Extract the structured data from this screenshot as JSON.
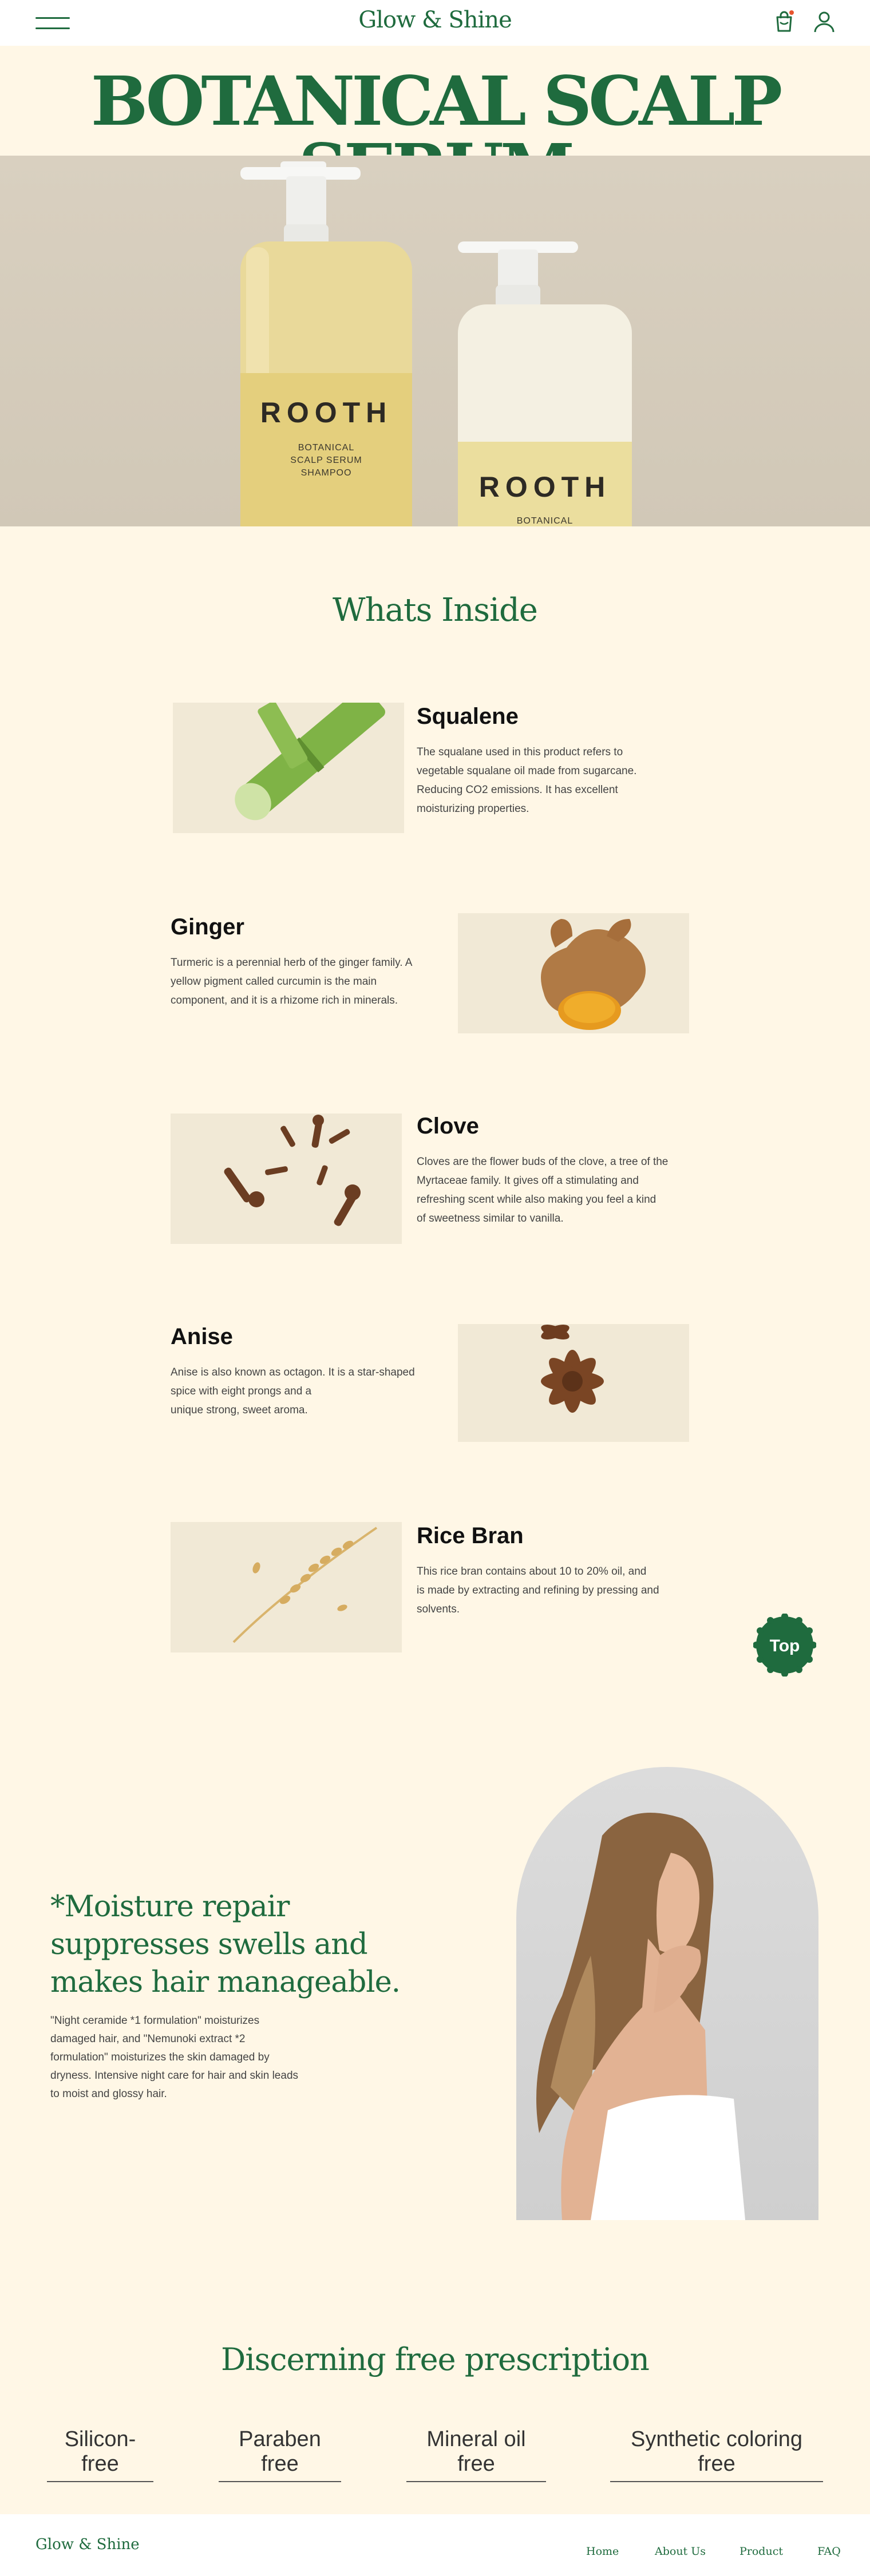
{
  "header": {
    "logo": "Glow & Shine"
  },
  "hero": {
    "title": "BOTANICAL SCALP SERUM",
    "bottle_left": {
      "brand": "ROOTH",
      "line1": "BOTANICAL",
      "line2": "SCALP SERUM",
      "line3": "SHAMPOO"
    },
    "bottle_right": {
      "brand": "ROOTH",
      "line1": "BOTANICAL"
    }
  },
  "whats_inside": {
    "title": "Whats Inside",
    "ingredients": [
      {
        "name": "Squalene",
        "desc": [
          "The squalane used in this product refers to",
          "vegetable squalane oil made from sugarcane.",
          "Reducing CO2 emissions. It has excellent",
          "moisturizing properties."
        ]
      },
      {
        "name": "Ginger",
        "desc": [
          "Turmeric is a perennial herb of the ginger family. A",
          "yellow pigment called curcumin is the main",
          "component, and it is a rhizome rich in minerals."
        ]
      },
      {
        "name": "Clove",
        "desc": [
          "Cloves are the flower buds of the clove, a tree of the",
          "Myrtaceae family. It gives off a stimulating and",
          "refreshing scent while also making you feel a kind",
          "of sweetness similar to vanilla."
        ]
      },
      {
        "name": "Anise",
        "desc": [
          "Anise is also known as octagon. It is a star-shaped",
          "spice with eight prongs and a",
          "unique strong, sweet aroma."
        ]
      },
      {
        "name": "Rice Bran",
        "desc": [
          "This rice bran contains about 10 to 20% oil, and",
          "is made by extracting and refining by pressing and",
          "solvents."
        ]
      }
    ]
  },
  "top_button": "Top",
  "moisture": {
    "title": [
      "*Moisture repair",
      "suppresses swells and",
      "makes hair manageable."
    ],
    "desc": [
      "\"Night ceramide *1 formulation\" moisturizes",
      "damaged hair, and \"Nemunoki extract *2",
      "formulation\" moisturizes the skin damaged by",
      "dryness. Intensive night care for hair and skin leads",
      "to moist and glossy hair."
    ]
  },
  "prescription": {
    "title": "Discerning free prescription",
    "items": [
      "Silicon-free",
      "Paraben free",
      "Mineral oil free",
      "Synthetic coloring free"
    ]
  },
  "footer": {
    "logo": "Glow & Shine",
    "links": [
      "Home",
      "About Us",
      "Product",
      "FAQ"
    ]
  },
  "colors": {
    "brand_green": "#1f6b3e",
    "background": "#fff7e6",
    "ingredient_bg": "#f1e9d6"
  }
}
